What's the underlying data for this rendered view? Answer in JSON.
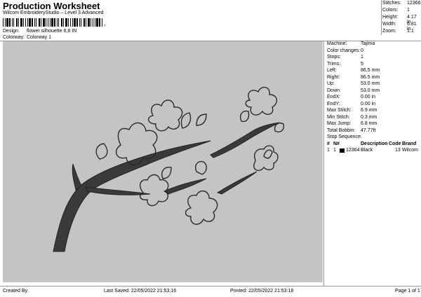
{
  "header": {
    "title": "Production Worksheet",
    "subtitle": "Wilcom EmbroideryStudio – Level 3 Advanced",
    "barcode_suffix": ","
  },
  "info": [
    {
      "label": "Design:",
      "value": "flower silhouette 6,8 IN"
    },
    {
      "label": "Colorway:",
      "value": "Colorway 1"
    }
  ],
  "stats": [
    {
      "label": "Stitches:",
      "value": "12366"
    },
    {
      "label": "Colors:",
      "value": "1"
    },
    {
      "label": "Height:",
      "value": "4.17 in"
    },
    {
      "label": "Width:",
      "value": "6.81 in"
    },
    {
      "label": "Zoom:",
      "value": "1:1"
    }
  ],
  "details": [
    {
      "label": "Machine:",
      "value": "Tajima"
    },
    {
      "label": "Color changes:",
      "value": "0"
    },
    {
      "label": "Stops:",
      "value": "1"
    },
    {
      "label": "Trims:",
      "value": "5"
    },
    {
      "label": "Left:",
      "value": "86.5 mm"
    },
    {
      "label": "Right:",
      "value": "86.5 mm"
    },
    {
      "label": "Up:",
      "value": "53.0 mm"
    },
    {
      "label": "Down:",
      "value": "53.0 mm"
    },
    {
      "label": "EndX:",
      "value": "0.00 in"
    },
    {
      "label": "EndY:",
      "value": "0.00 in"
    },
    {
      "label": "Max Stitch:",
      "value": "6.9 mm"
    },
    {
      "label": "Min Stitch:",
      "value": "0.3 mm"
    },
    {
      "label": "Max Jump:",
      "value": "6.8 mm"
    },
    {
      "label": "Total Bobbin:",
      "value": "47.77ft"
    }
  ],
  "stop_sequence": {
    "label": "Stop Sequence:",
    "headers": {
      "num": "#",
      "n": "N#",
      "description": "Description",
      "code": "Code",
      "brand": "Brand"
    },
    "rows": [
      {
        "num": "1",
        "n": "1",
        "stitches": "12364",
        "description": "Black",
        "code": "13",
        "brand": "Wilcom",
        "color": "#000000"
      }
    ]
  },
  "footer": {
    "created_by": "Created By:",
    "last_saved": "Last Saved: 22/05/2022 21:53:16",
    "printed": "Printed: 22/05/2022 21:53:18",
    "page": "Page 1 of 1"
  },
  "colors": {
    "canvas_bg": "#c4c4c4",
    "thread": "#3a3a3a"
  }
}
